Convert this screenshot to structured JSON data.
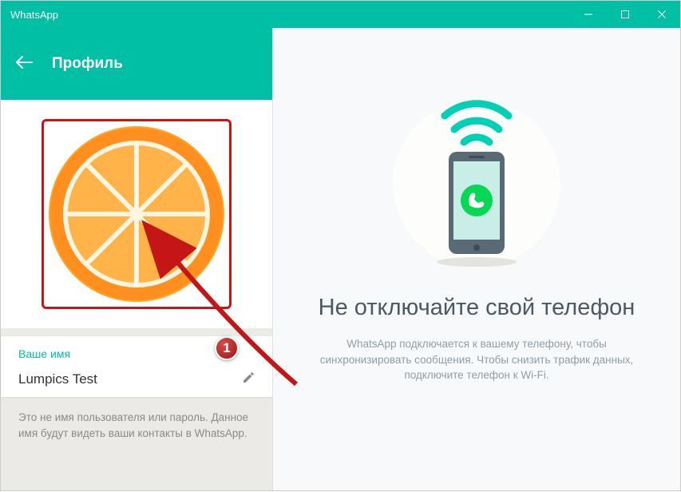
{
  "window": {
    "title": "WhatsApp"
  },
  "profile": {
    "header_title": "Профиль",
    "name_label": "Ваше имя",
    "name_value": "Lumpics Test",
    "name_desc": "Это не имя пользователя или пароль. Данное имя будут видеть ваши контакты в WhatsApp."
  },
  "right": {
    "heading": "Не отключайте свой телефон",
    "desc": "WhatsApp подключается к вашему телефону, чтобы синхронизировать сообщения. Чтобы снизить трафик данных, подключите телефон к Wi-Fi."
  },
  "annotation": {
    "step": "1"
  }
}
